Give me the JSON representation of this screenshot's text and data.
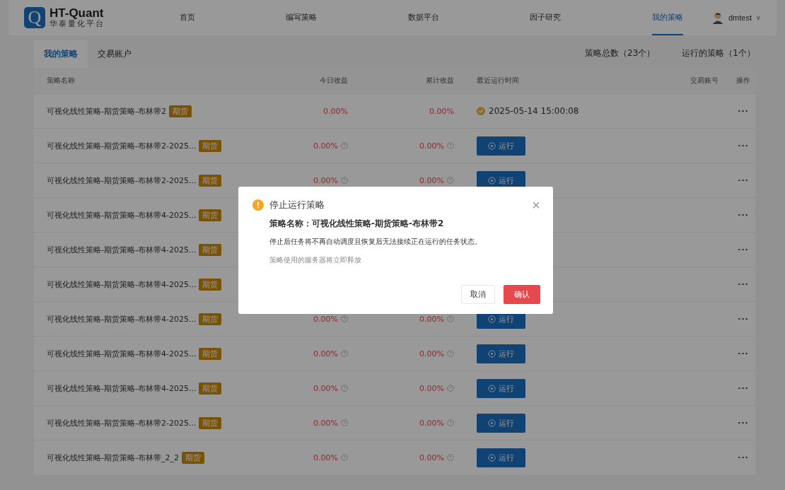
{
  "logo": {
    "letter": "Q",
    "title": "HT-Quant",
    "subtitle": "华泰量化平台"
  },
  "nav": [
    {
      "label": "首页",
      "selected": false
    },
    {
      "label": "编写策略",
      "selected": false
    },
    {
      "label": "数据平台",
      "selected": false
    },
    {
      "label": "因子研究",
      "selected": false
    },
    {
      "label": "我的策略",
      "selected": true
    }
  ],
  "user": {
    "name": "dmtest",
    "caret": "∨"
  },
  "tabs": [
    {
      "label": "我的策略",
      "selected": true
    },
    {
      "label": "交易账户",
      "selected": false
    }
  ],
  "summary": [
    "策略总数（23个）",
    "运行的策略（1个）"
  ],
  "table": {
    "columns": [
      "策略名称",
      "今日收益",
      "累计收益",
      "最近运行时间",
      "交易账号",
      "操作"
    ],
    "rows": [
      {
        "name": "可视化线性策略-期货策略-布林带2",
        "tag": "期货",
        "today": "0.00%",
        "total": "0.00%",
        "kind": "running",
        "time": "2025-05-14 15:00:08",
        "ops": "···"
      },
      {
        "name": "可视化线性策略-期货策略-布林带2-2025...",
        "tag": "期货",
        "today": "0.00%",
        "total": "0.00%",
        "kind": "stopped",
        "run": "运行",
        "ops": "···"
      },
      {
        "name": "可视化线性策略-期货策略-布林带2-2025...",
        "tag": "期货",
        "today": "0.00%",
        "total": "0.00%",
        "kind": "stopped",
        "run": "运行",
        "ops": "···"
      },
      {
        "name": "可视化线性策略-期货策略-布林带4-2025...",
        "tag": "期货",
        "kind": "hidden",
        "ops": "···"
      },
      {
        "name": "可视化线性策略-期货策略-布林带4-2025...",
        "tag": "期货",
        "kind": "hidden",
        "ops": "···"
      },
      {
        "name": "可视化线性策略-期货策略-布林带4-2025...",
        "tag": "期货",
        "kind": "hidden",
        "ops": "···"
      },
      {
        "name": "可视化线性策略-期货策略-布林带4-2025...",
        "tag": "期货",
        "today": "0.00%",
        "total": "0.00%",
        "kind": "stopped",
        "run": "运行",
        "ops": "···"
      },
      {
        "name": "可视化线性策略-期货策略-布林带4-2025...",
        "tag": "期货",
        "today": "0.00%",
        "total": "0.00%",
        "kind": "stopped",
        "run": "运行",
        "ops": "···"
      },
      {
        "name": "可视化线性策略-期货策略-布林带4-2025...",
        "tag": "期货",
        "today": "0.00%",
        "total": "0.00%",
        "kind": "stopped",
        "run": "运行",
        "ops": "···"
      },
      {
        "name": "可视化线性策略-期货策略-布林带2-2025...",
        "tag": "期货",
        "today": "0.00%",
        "total": "0.00%",
        "kind": "stopped",
        "run": "运行",
        "ops": "···"
      },
      {
        "name": "可视化线性策略-期货策略-布林带_2_2",
        "tag": "期货",
        "today": "0.00%",
        "total": "0.00%",
        "kind": "stopped",
        "run": "运行",
        "ops": "···"
      }
    ]
  },
  "dialog": {
    "title": "停止运行策略",
    "heading": "策略名称：可视化线性策略-期货策略-布林带2",
    "message": "停止后任务将不再自动调度且恢复后无法接续正在运行的任务状态。",
    "note": "策略使用的服务器将立即释放",
    "close": "×",
    "buttons": [
      {
        "label": "取消",
        "kind": "default"
      },
      {
        "label": "确认",
        "kind": "danger"
      }
    ]
  }
}
